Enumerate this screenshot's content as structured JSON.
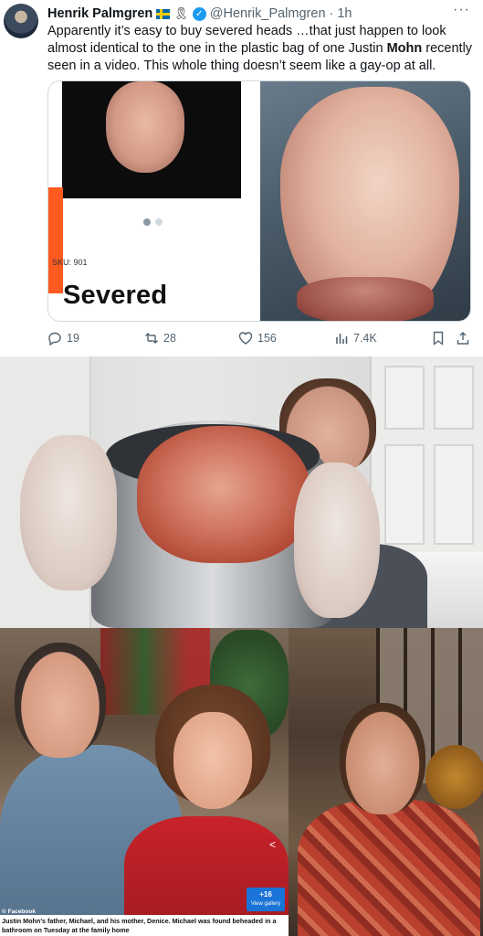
{
  "tweet": {
    "author_name": "Henrik Palmgren",
    "ribbon_icon": "awareness-ribbon",
    "handle": "@Henrik_Palmgren",
    "separator": "·",
    "time": "1h",
    "more_label": "···",
    "text_before": "Apparently it’s easy to buy severed  heads …that just happen to look almost identical to the one in the plastic bag of one Justin ",
    "text_bold": "Mohn",
    "text_after": " recently seen in a video. This whole thing doesn’t seem like a gay-op at all.",
    "media": {
      "sku": "SKU: 901",
      "product_title": "Severed",
      "carousel_pages": 2,
      "carousel_active": 1
    },
    "actions": {
      "replies": "19",
      "reposts": "28",
      "likes": "156",
      "views": "7.4K"
    },
    "colors": {
      "accent": "#1d9bf0",
      "muted": "#536471",
      "product_tab": "#ff5a1f"
    }
  },
  "news_photo": {
    "credit": "© Facebook",
    "share_icon": "share-icon",
    "gallery_count": "+16",
    "gallery_label": "View gallery",
    "caption": "Justin Mohn's father, Michael, and his mother, Denice. Michael was found beheaded in a bathroom on Tuesday at the family home"
  }
}
